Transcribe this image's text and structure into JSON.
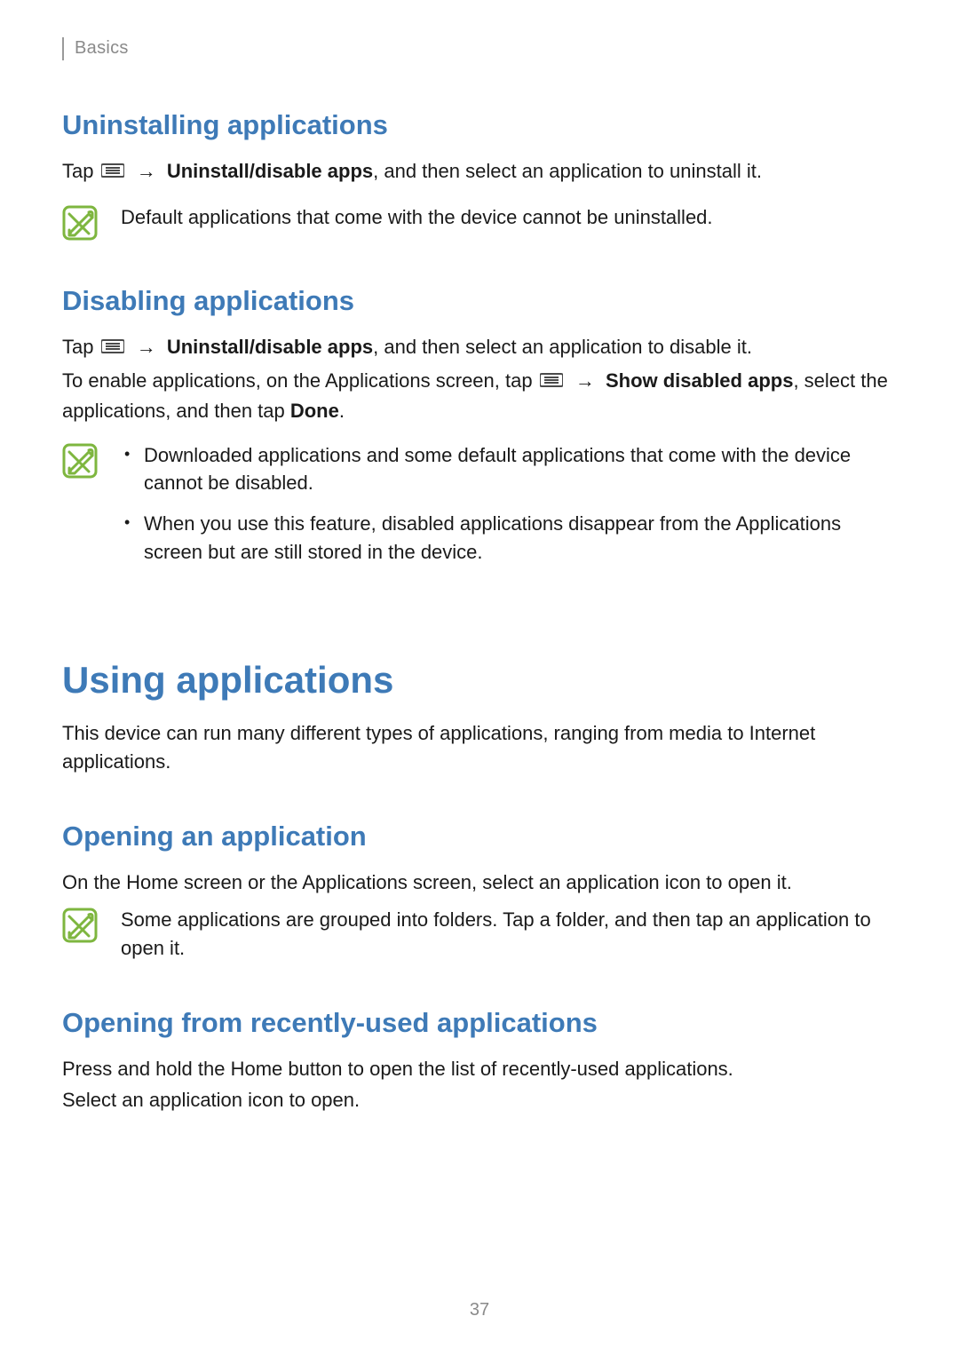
{
  "breadcrumb": "Basics",
  "sections": {
    "uninstalling": {
      "heading": "Uninstalling applications",
      "p1_a": "Tap ",
      "p1_arrow": "→",
      "p1_bold": "Uninstall/disable apps",
      "p1_b": ", and then select an application to uninstall it.",
      "note1": "Default applications that come with the device cannot be uninstalled."
    },
    "disabling": {
      "heading": "Disabling applications",
      "p1_a": "Tap ",
      "p1_arrow": "→",
      "p1_bold": "Uninstall/disable apps",
      "p1_b": ", and then select an application to disable it.",
      "p2_a": "To enable applications, on the Applications screen, tap ",
      "p2_arrow": "→",
      "p2_bold1": "Show disabled apps",
      "p2_b": ", select the applications, and then tap ",
      "p2_bold2": "Done",
      "p2_c": ".",
      "note_bullets": {
        "b1": "Downloaded applications and some default applications that come with the device cannot be disabled.",
        "b2": "When you use this feature, disabled applications disappear from the Applications screen but are still stored in the device."
      }
    },
    "using": {
      "heading": "Using applications",
      "intro": "This device can run many different types of applications, ranging from media to Internet applications."
    },
    "opening": {
      "heading": "Opening an application",
      "p1": "On the Home screen or the Applications screen, select an application icon to open it.",
      "note": "Some applications are grouped into folders. Tap a folder, and then tap an application to open it."
    },
    "recent": {
      "heading": "Opening from recently-used applications",
      "p1": "Press and hold the Home button to open the list of recently-used applications.",
      "p2": "Select an application icon to open."
    }
  },
  "page_number": "37"
}
